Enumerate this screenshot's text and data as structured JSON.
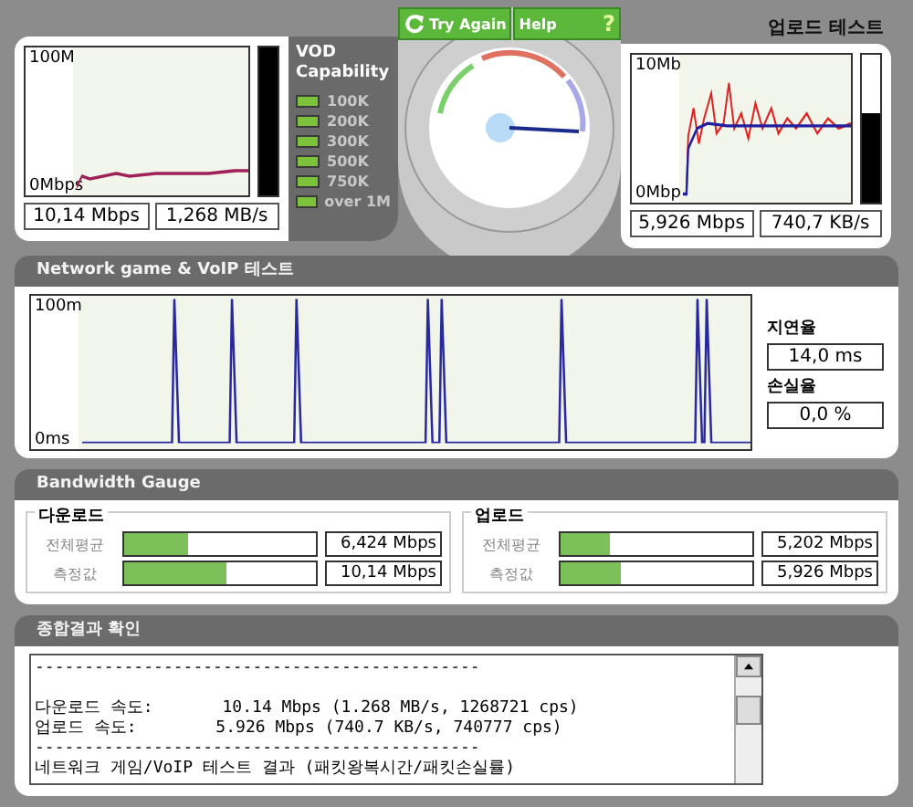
{
  "download_test": {
    "axis_top": "100M",
    "axis_bottom": "0Mbps",
    "meter": {
      "level": 1
    },
    "readings": [
      "10,14 Mbps",
      "1,268 MB/s"
    ]
  },
  "vod": {
    "title": "VOD Capability",
    "items": [
      "100K",
      "200K",
      "300K",
      "500K",
      "750K",
      "over 1M"
    ]
  },
  "gauge": {
    "buttons": [
      {
        "kind": "retry",
        "label": "Try Again"
      },
      {
        "kind": "help",
        "label": "Help",
        "icon": "?"
      }
    ]
  },
  "upload_test": {
    "title": "업로드 테스트",
    "axis_top": "10Mb",
    "axis_bottom": "0Mbp",
    "meter": {
      "level": 0.6
    },
    "readings": [
      "5,926 Mbps",
      "740,7 KB/s"
    ]
  },
  "network_test": {
    "title": "Network game & VoIP 테스트",
    "axis_top": "100m",
    "axis_bottom": "0ms",
    "latency_label": "지연율",
    "latency": "14,0 ms",
    "loss_label": "손실율",
    "loss": "0,0 %"
  },
  "bandwidth": {
    "title": "Bandwidth Gauge",
    "groups": [
      {
        "title": "다운로드",
        "rows": [
          {
            "label": "전체평균",
            "level": 0.33,
            "value": "6,424 Mbps"
          },
          {
            "label": "측정값",
            "level": 0.53,
            "value": "10,14 Mbps"
          }
        ]
      },
      {
        "title": "업로드",
        "rows": [
          {
            "label": "전체평균",
            "level": 0.26,
            "value": "5,202 Mbps"
          },
          {
            "label": "측정값",
            "level": 0.31,
            "value": "5,926 Mbps"
          }
        ]
      }
    ]
  },
  "summary": {
    "title": "종합결과 확인",
    "lines": [
      "---------------------------------------------",
      "다운로드 속도:       10.14 Mbps (1.268 MB/s, 1268721 cps)",
      "업로드 속도:        5.926 Mbps (740.7 KB/s, 740777 cps)",
      "---------------------------------------------",
      "네트워크 게임/VoIP 테스트 결과 (패킷왕복시간/패킷손실률)"
    ]
  }
}
